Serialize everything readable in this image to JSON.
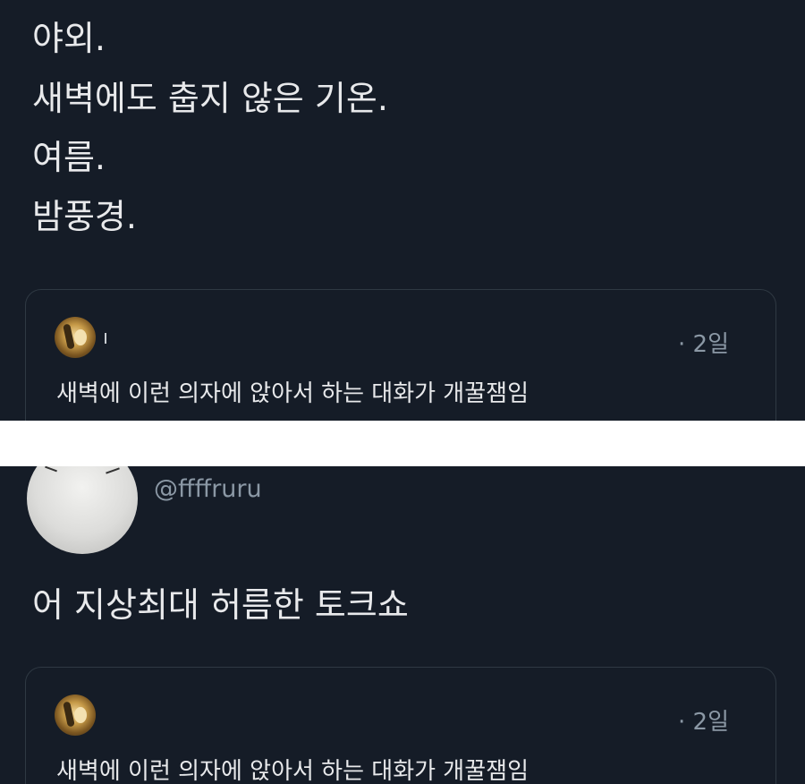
{
  "top_tweet": {
    "lines": [
      "야외.",
      "새벽에도 춥지 않은 기온.",
      "여름.",
      "밤풍경."
    ],
    "quote": {
      "time": "· 2일",
      "text": "새벽에 이런 의자에 앉아서 하는 대화가 개꿀잼임"
    }
  },
  "bottom_tweet": {
    "handle": "@ffffruru",
    "text": "어 지상최대 허름한 토크쇼",
    "quote": {
      "time": "· 2일",
      "text": "새벽에 이런 의자에 앉아서 하는 대화가 개꿀잼임"
    }
  },
  "colors": {
    "background": "#151c27",
    "text": "#e8e9eb",
    "muted": "#8b98a5",
    "card_border": "#2f3943",
    "divider": "#ffffff"
  }
}
